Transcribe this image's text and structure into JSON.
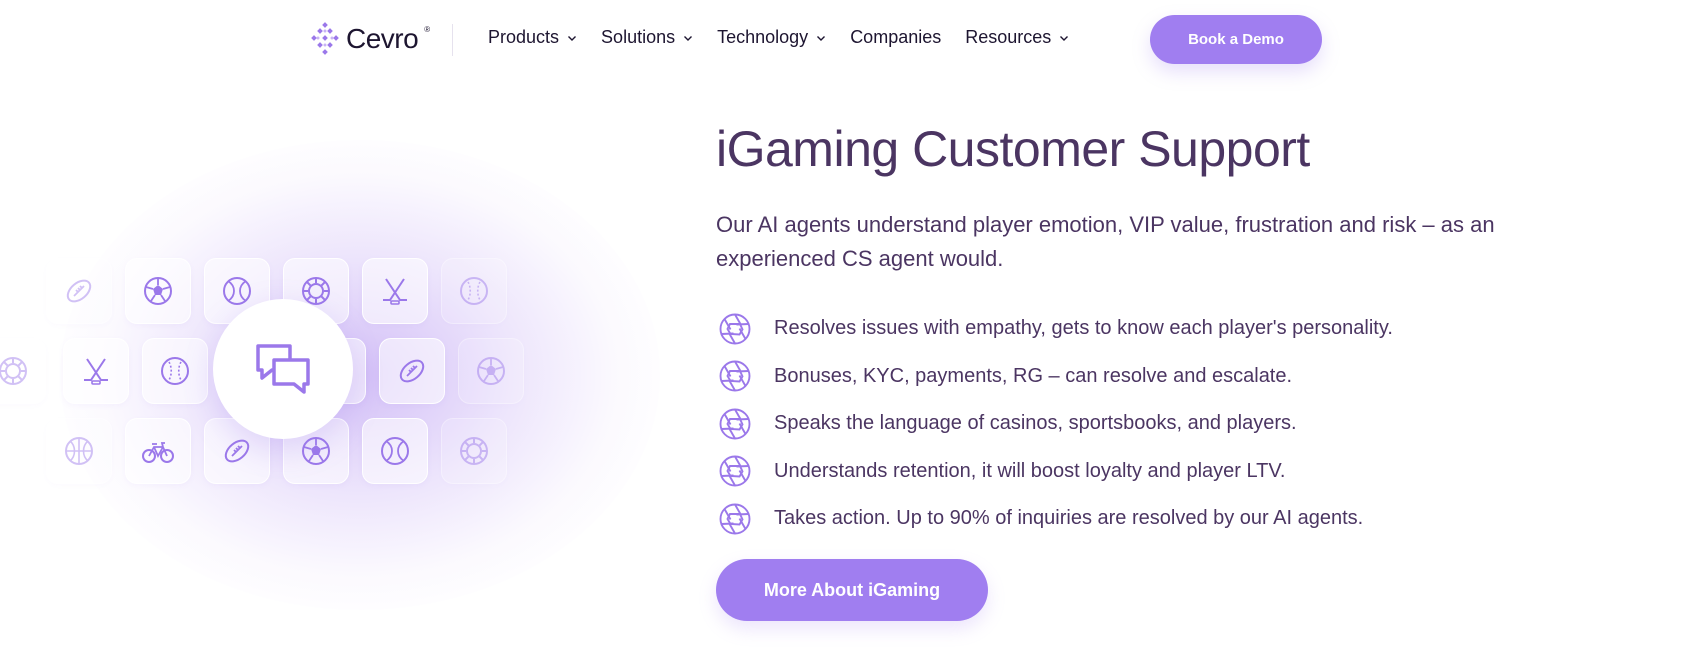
{
  "nav": {
    "logo_text": "Cevro",
    "logo_reg": "®",
    "menu": [
      {
        "label": "Products",
        "has_dropdown": true
      },
      {
        "label": "Solutions",
        "has_dropdown": true
      },
      {
        "label": "Technology",
        "has_dropdown": true
      },
      {
        "label": "Companies",
        "has_dropdown": false
      },
      {
        "label": "Resources",
        "has_dropdown": true
      }
    ],
    "cta_label": "Book a Demo"
  },
  "hero": {
    "title": "iGaming Customer Support",
    "subtitle": "Our AI agents understand player emotion, VIP value, frustration and risk – as an experienced CS agent would.",
    "features": [
      "Resolves issues with empathy, gets to know each player's personality.",
      "Bonuses, KYC, payments, RG – can resolve and escalate.",
      "Speaks the language of casinos, sportsbooks, and players.",
      "Understands retention, it will boost loyalty and player LTV.",
      "Takes action. Up to 90% of inquiries are resolved by our AI agents."
    ],
    "feature_icon": "aperture-icon",
    "cta_label": "More About iGaming"
  },
  "illustration": {
    "center_icon": "chat-bubbles-icon",
    "tile_icons": [
      "football-icon",
      "soccer-ball-icon",
      "tennis-ball-icon",
      "poker-chip-icon",
      "hockey-sticks-icon",
      "baseball-icon",
      "basketball-icon",
      "bicycle-icon"
    ]
  },
  "colors": {
    "accent": "#a07ef0",
    "heading": "#4b3562",
    "text": "#1d1530",
    "icon": "#9b78ea"
  }
}
